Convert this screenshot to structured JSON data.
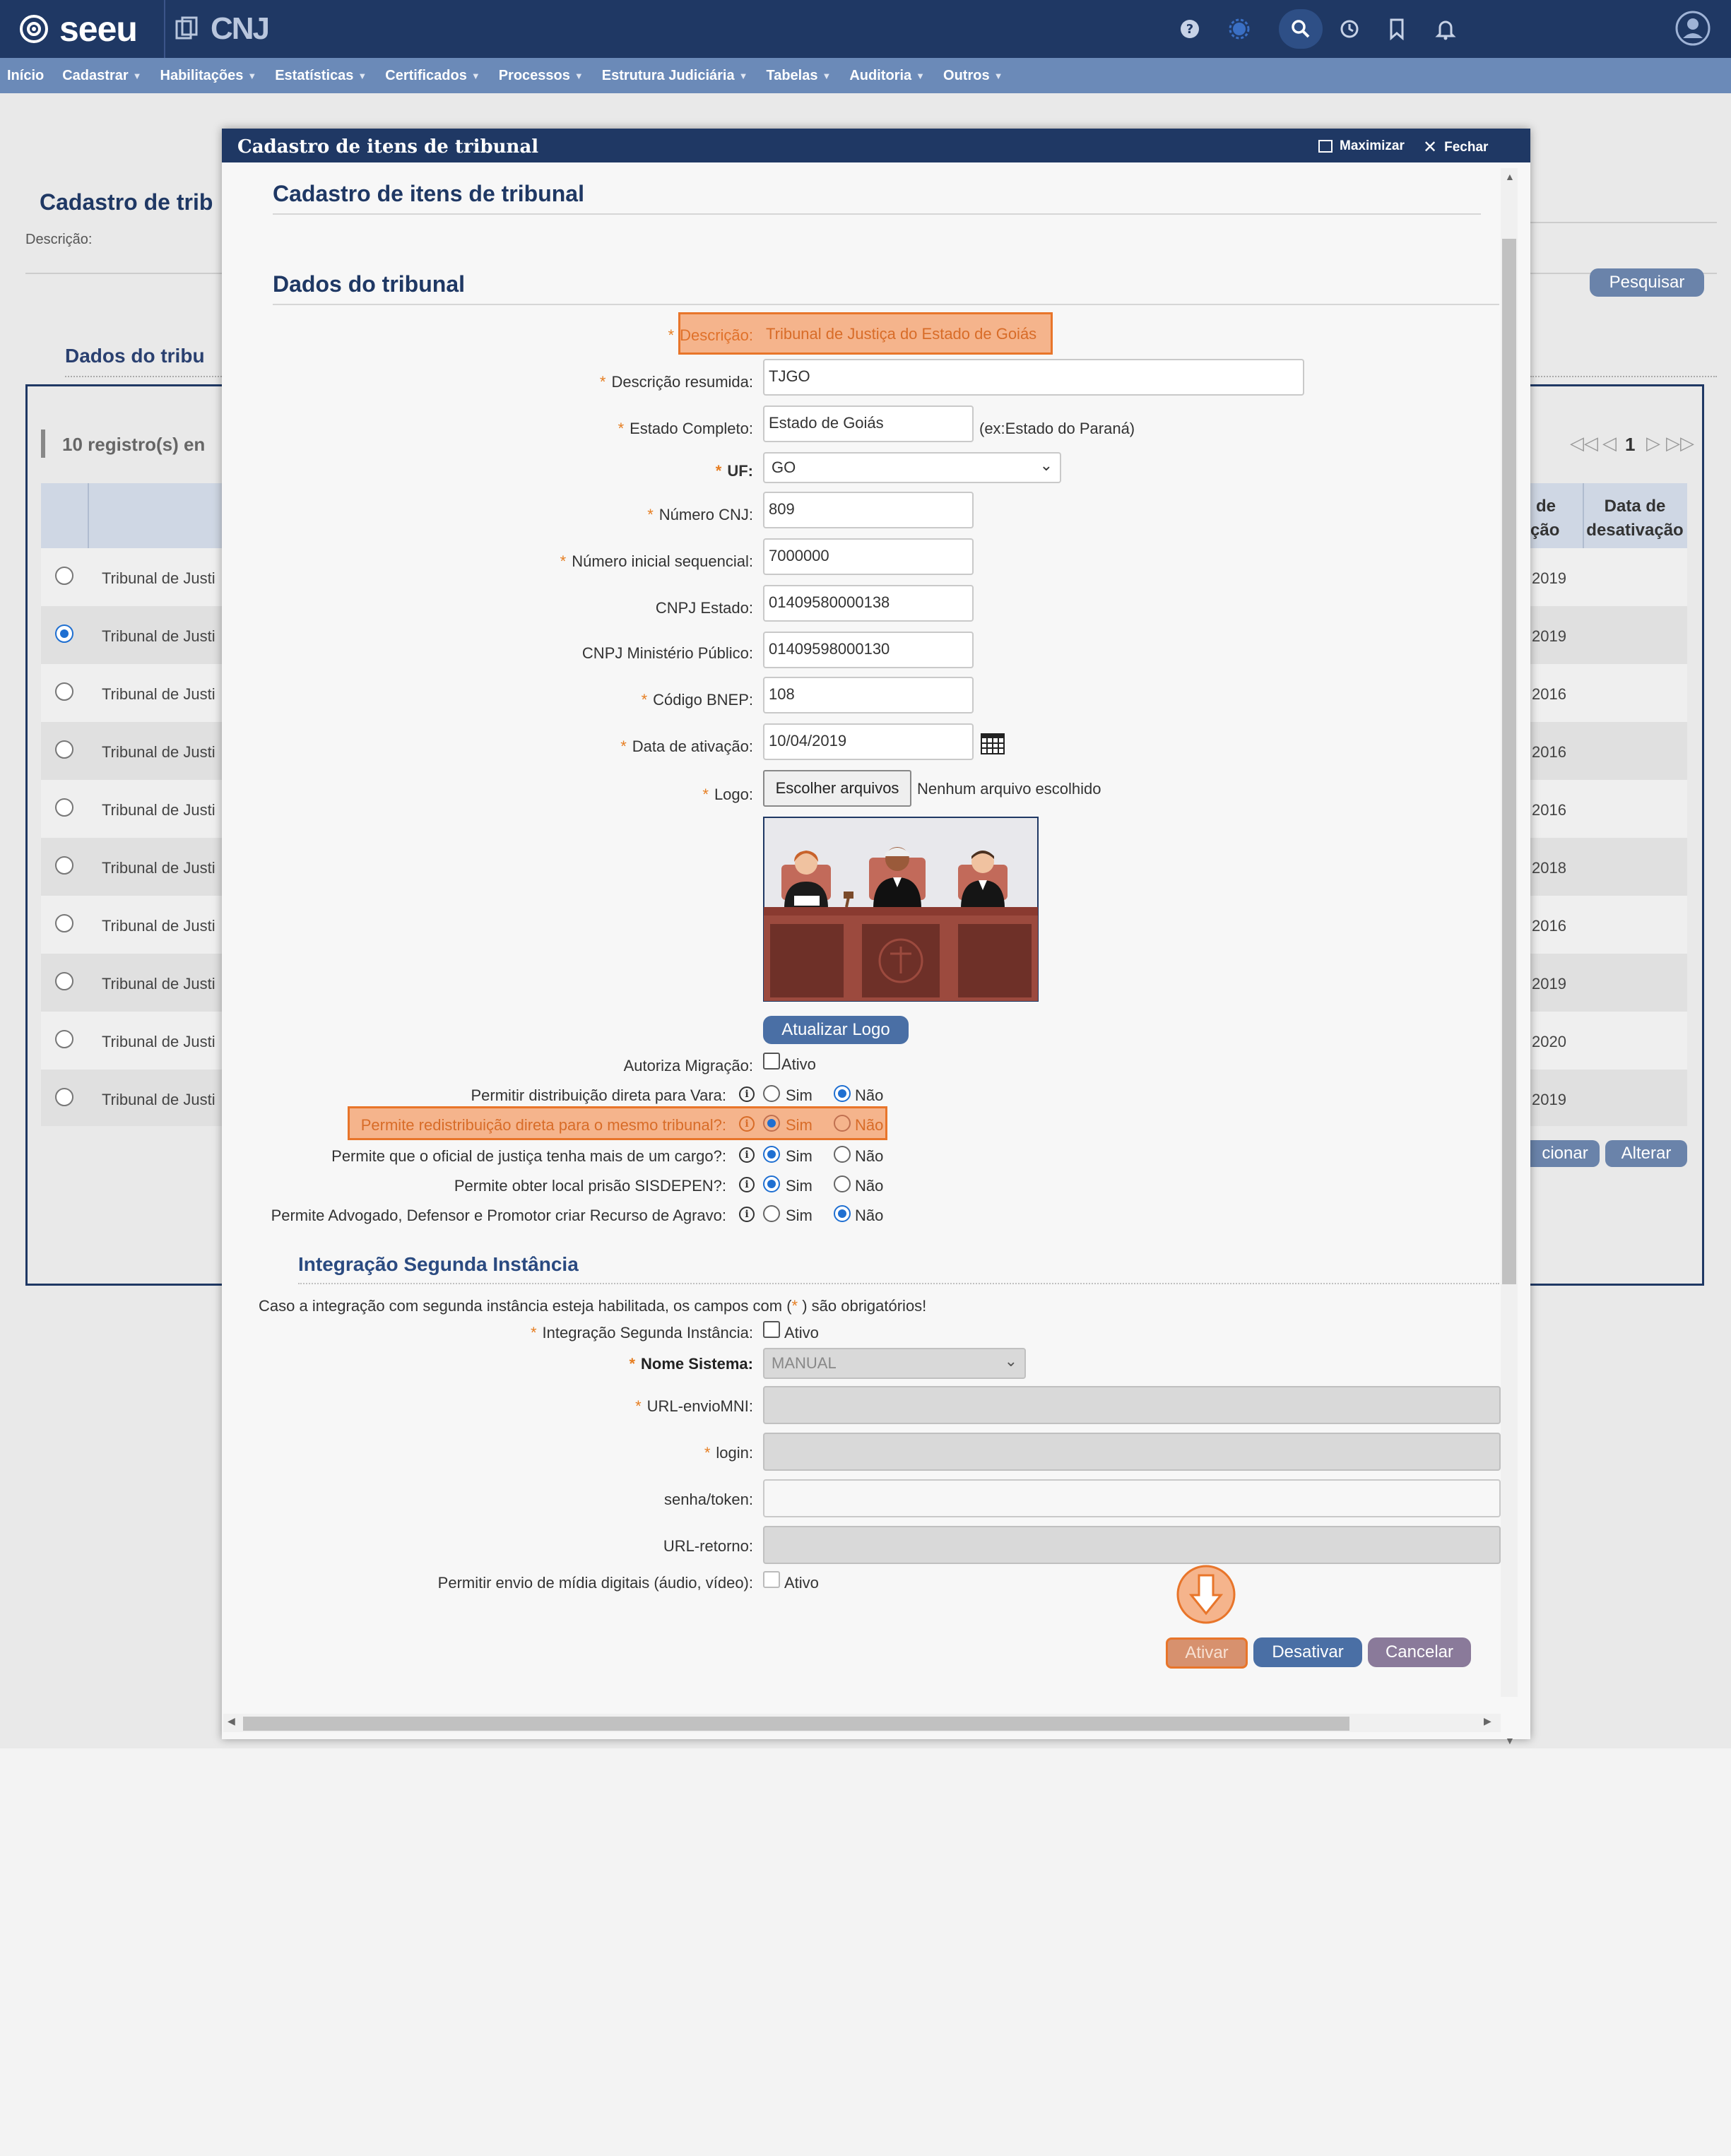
{
  "app": {
    "name": "seeu",
    "partner": "CNJ"
  },
  "menu": [
    "Início",
    "Cadastrar",
    "Habilitações",
    "Estatísticas",
    "Certificados",
    "Processos",
    "Estrutura Judiciária",
    "Tabelas",
    "Auditoria",
    "Outros"
  ],
  "background": {
    "page_title": "Cadastro de trib",
    "descricao_label": "Descrição:",
    "search_button": "Pesquisar",
    "section_title": "Dados do tribu",
    "records_text": "10 registro(s) en",
    "pagination_page": "1",
    "col_de": "de",
    "col_cao": "ção",
    "col_data_desativacao_1": "Data de",
    "col_data_desativacao_2": "desativação",
    "rows": [
      {
        "name": "Tribunal de Justi",
        "year": "2019",
        "selected": false
      },
      {
        "name": "Tribunal de Justi",
        "year": "2019",
        "selected": true
      },
      {
        "name": "Tribunal de Justi",
        "year": "2016",
        "selected": false
      },
      {
        "name": "Tribunal de Justi",
        "year": "2016",
        "selected": false
      },
      {
        "name": "Tribunal de Justi",
        "year": "2016",
        "selected": false
      },
      {
        "name": "Tribunal de Justi",
        "year": "2018",
        "selected": false
      },
      {
        "name": "Tribunal de Justi",
        "year": "2016",
        "selected": false
      },
      {
        "name": "Tribunal de Justi",
        "year": "2019",
        "selected": false
      },
      {
        "name": "Tribunal de Justi",
        "year": "2020",
        "selected": false
      },
      {
        "name": "Tribunal de Justi",
        "year": "2019",
        "selected": false
      }
    ],
    "btn_adicionar": "cionar",
    "btn_alterar": "Alterar"
  },
  "modal": {
    "title": "Cadastro de itens de tribunal",
    "maximize": "Maximizar",
    "close": "Fechar",
    "heading": "Cadastro de itens de tribunal",
    "section": "Dados do tribunal",
    "fields": {
      "descricao": {
        "label": "Descrição:",
        "value": "Tribunal de Justiça do Estado de Goiás"
      },
      "descricao_resumida": {
        "label": "Descrição resumida:",
        "value": "TJGO"
      },
      "estado_completo": {
        "label": "Estado Completo:",
        "value": "Estado de Goiás",
        "hint": "(ex:Estado do Paraná)"
      },
      "uf": {
        "label": "UF:",
        "value": "GO"
      },
      "numero_cnj": {
        "label": "Número CNJ:",
        "value": "809"
      },
      "numero_inicial": {
        "label": "Número inicial sequencial:",
        "value": "7000000"
      },
      "cnpj_estado": {
        "label": "CNPJ Estado:",
        "value": "01409580000138"
      },
      "cnpj_mp": {
        "label": "CNPJ Ministério Público:",
        "value": "01409598000130"
      },
      "codigo_bnep": {
        "label": "Código BNEP:",
        "value": "108"
      },
      "data_ativacao": {
        "label": "Data de ativação:",
        "value": "10/04/2019"
      },
      "logo": {
        "label": "Logo:",
        "button": "Escolher arquivos",
        "status": "Nenhum arquivo escolhido"
      }
    },
    "update_logo": "Atualizar Logo",
    "autoriza_migracao": {
      "label": "Autoriza Migração:",
      "option": "Ativo"
    },
    "radio_yes": "Sim",
    "radio_no": "Não",
    "options": [
      {
        "label": "Permitir distribuição direta para Vara:",
        "value": "Não"
      },
      {
        "label": "Permite redistribuição direta para o mesmo tribunal?:",
        "value": "Sim"
      },
      {
        "label": "Permite que o oficial de justiça tenha mais de um cargo?:",
        "value": "Sim"
      },
      {
        "label": "Permite obter local prisão SISDEPEN?:",
        "value": "Sim"
      },
      {
        "label": "Permite Advogado, Defensor e Promotor criar Recurso de Agravo:",
        "value": "Não"
      }
    ],
    "integracao": {
      "title": "Integração Segunda Instância",
      "note_pre": "Caso a integração com segunda instância esteja habilitada, os campos com (",
      "note_star": "*",
      "note_post": " ) são obrigatórios!",
      "enable_label": "Integração Segunda Instância:",
      "enable_option": "Ativo",
      "nome_sistema_label": "Nome Sistema:",
      "nome_sistema_value": "MANUAL",
      "url_envio_label": "URL-envioMNI:",
      "login_label": "login:",
      "senha_label": "senha/token:",
      "url_retorno_label": "URL-retorno:",
      "midia_label": "Permitir envio de mídia digitais (áudio, vídeo):",
      "midia_option": "Ativo"
    },
    "buttons": {
      "ativar": "Ativar",
      "desativar": "Desativar",
      "cancelar": "Cancelar"
    }
  },
  "colors": {
    "header": "#1f3864",
    "menubar": "#6b8ab8",
    "highlight": "#f5b48c",
    "highlight_border": "#e8752a",
    "button_blue": "#4a6fa5",
    "button_purple": "#8a7a9a"
  }
}
